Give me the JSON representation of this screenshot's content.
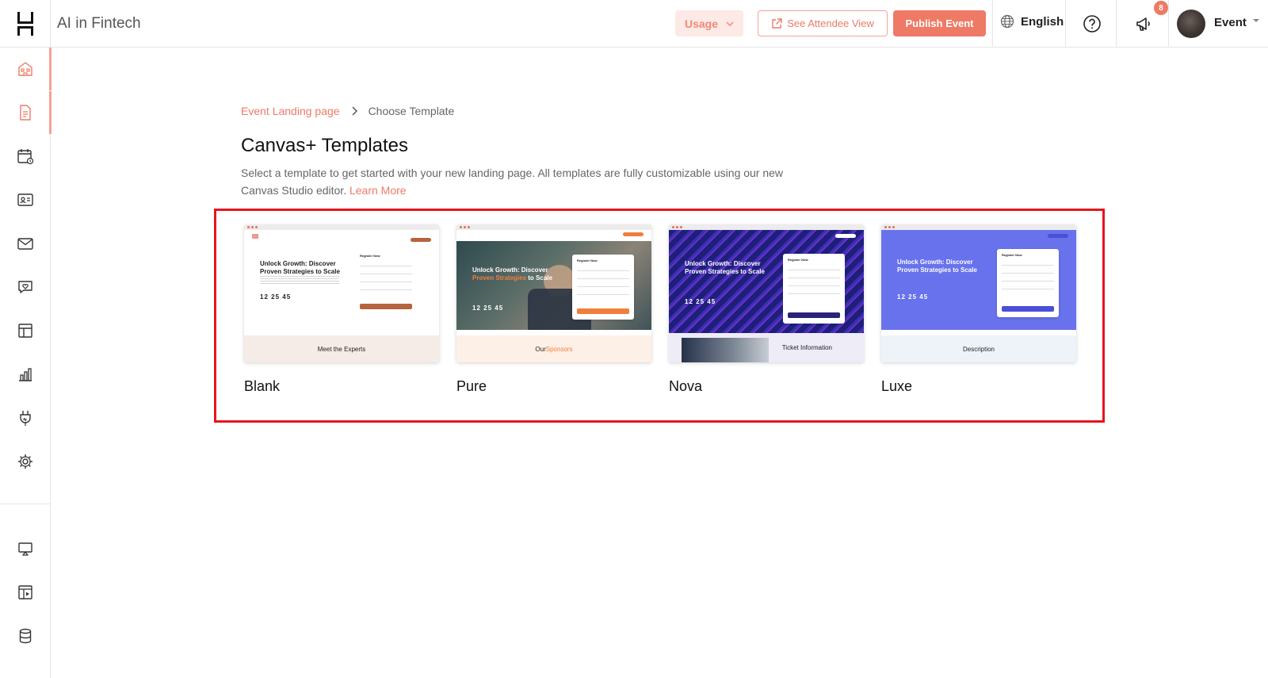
{
  "header": {
    "event_title": "AI in Fintech",
    "usage_label": "Usage",
    "attendee_view_label": "See Attendee View",
    "publish_label": "Publish Event",
    "language_label": "English",
    "notification_count": "8",
    "user_name": "Event"
  },
  "sidebar": {
    "items": [
      {
        "icon": "home-icon",
        "active": true
      },
      {
        "icon": "document-icon",
        "active": true
      },
      {
        "icon": "calendar-icon"
      },
      {
        "icon": "id-card-icon"
      },
      {
        "icon": "mail-icon"
      },
      {
        "icon": "chat-heart-icon"
      },
      {
        "icon": "layout-icon"
      },
      {
        "icon": "bar-chart-icon"
      },
      {
        "icon": "plug-icon"
      },
      {
        "icon": "gear-icon"
      },
      {
        "icon": "presentation-icon"
      },
      {
        "icon": "video-layout-icon"
      },
      {
        "icon": "database-icon"
      }
    ]
  },
  "breadcrumb": {
    "parent": "Event Landing page",
    "current": "Choose Template"
  },
  "main": {
    "title": "Canvas+ Templates",
    "description": "Select a template to get started with your new landing page. All templates are fully customizable using our new Canvas Studio editor.",
    "learn_more": "Learn More"
  },
  "templates": [
    {
      "name": "Blank",
      "preview": {
        "headline": "Unlock Growth: Discover Proven Strategies to Scale",
        "form_title": "Register Now",
        "countdown": "12 25 45",
        "footer_text": "Meet the Experts",
        "accent": "#b5643d"
      }
    },
    {
      "name": "Pure",
      "preview": {
        "headline_1": "Unlock Growth: Discover",
        "headline_2": "Proven Strategies",
        "headline_3": " to Scale",
        "form_title": "Register Now",
        "countdown": "12 25 45",
        "footer_prefix": "Our ",
        "footer_highlight": "Sponsors",
        "accent": "#f07f3c"
      }
    },
    {
      "name": "Nova",
      "preview": {
        "headline": "Unlock Growth: Discover Proven Strategies to Scale",
        "form_title": "Register Now",
        "countdown": "12 25 45",
        "footer_text": "Ticket Information",
        "accent": "#2a237a"
      }
    },
    {
      "name": "Luxe",
      "preview": {
        "headline": "Unlock Growth: Discover Proven Strategies to Scale",
        "form_title": "Register Now",
        "countdown": "12 25 45",
        "footer_text": "Description",
        "accent": "#4a4fd6"
      }
    }
  ],
  "colors": {
    "accent": "#ee7a66",
    "highlight_border": "#e8141c"
  }
}
